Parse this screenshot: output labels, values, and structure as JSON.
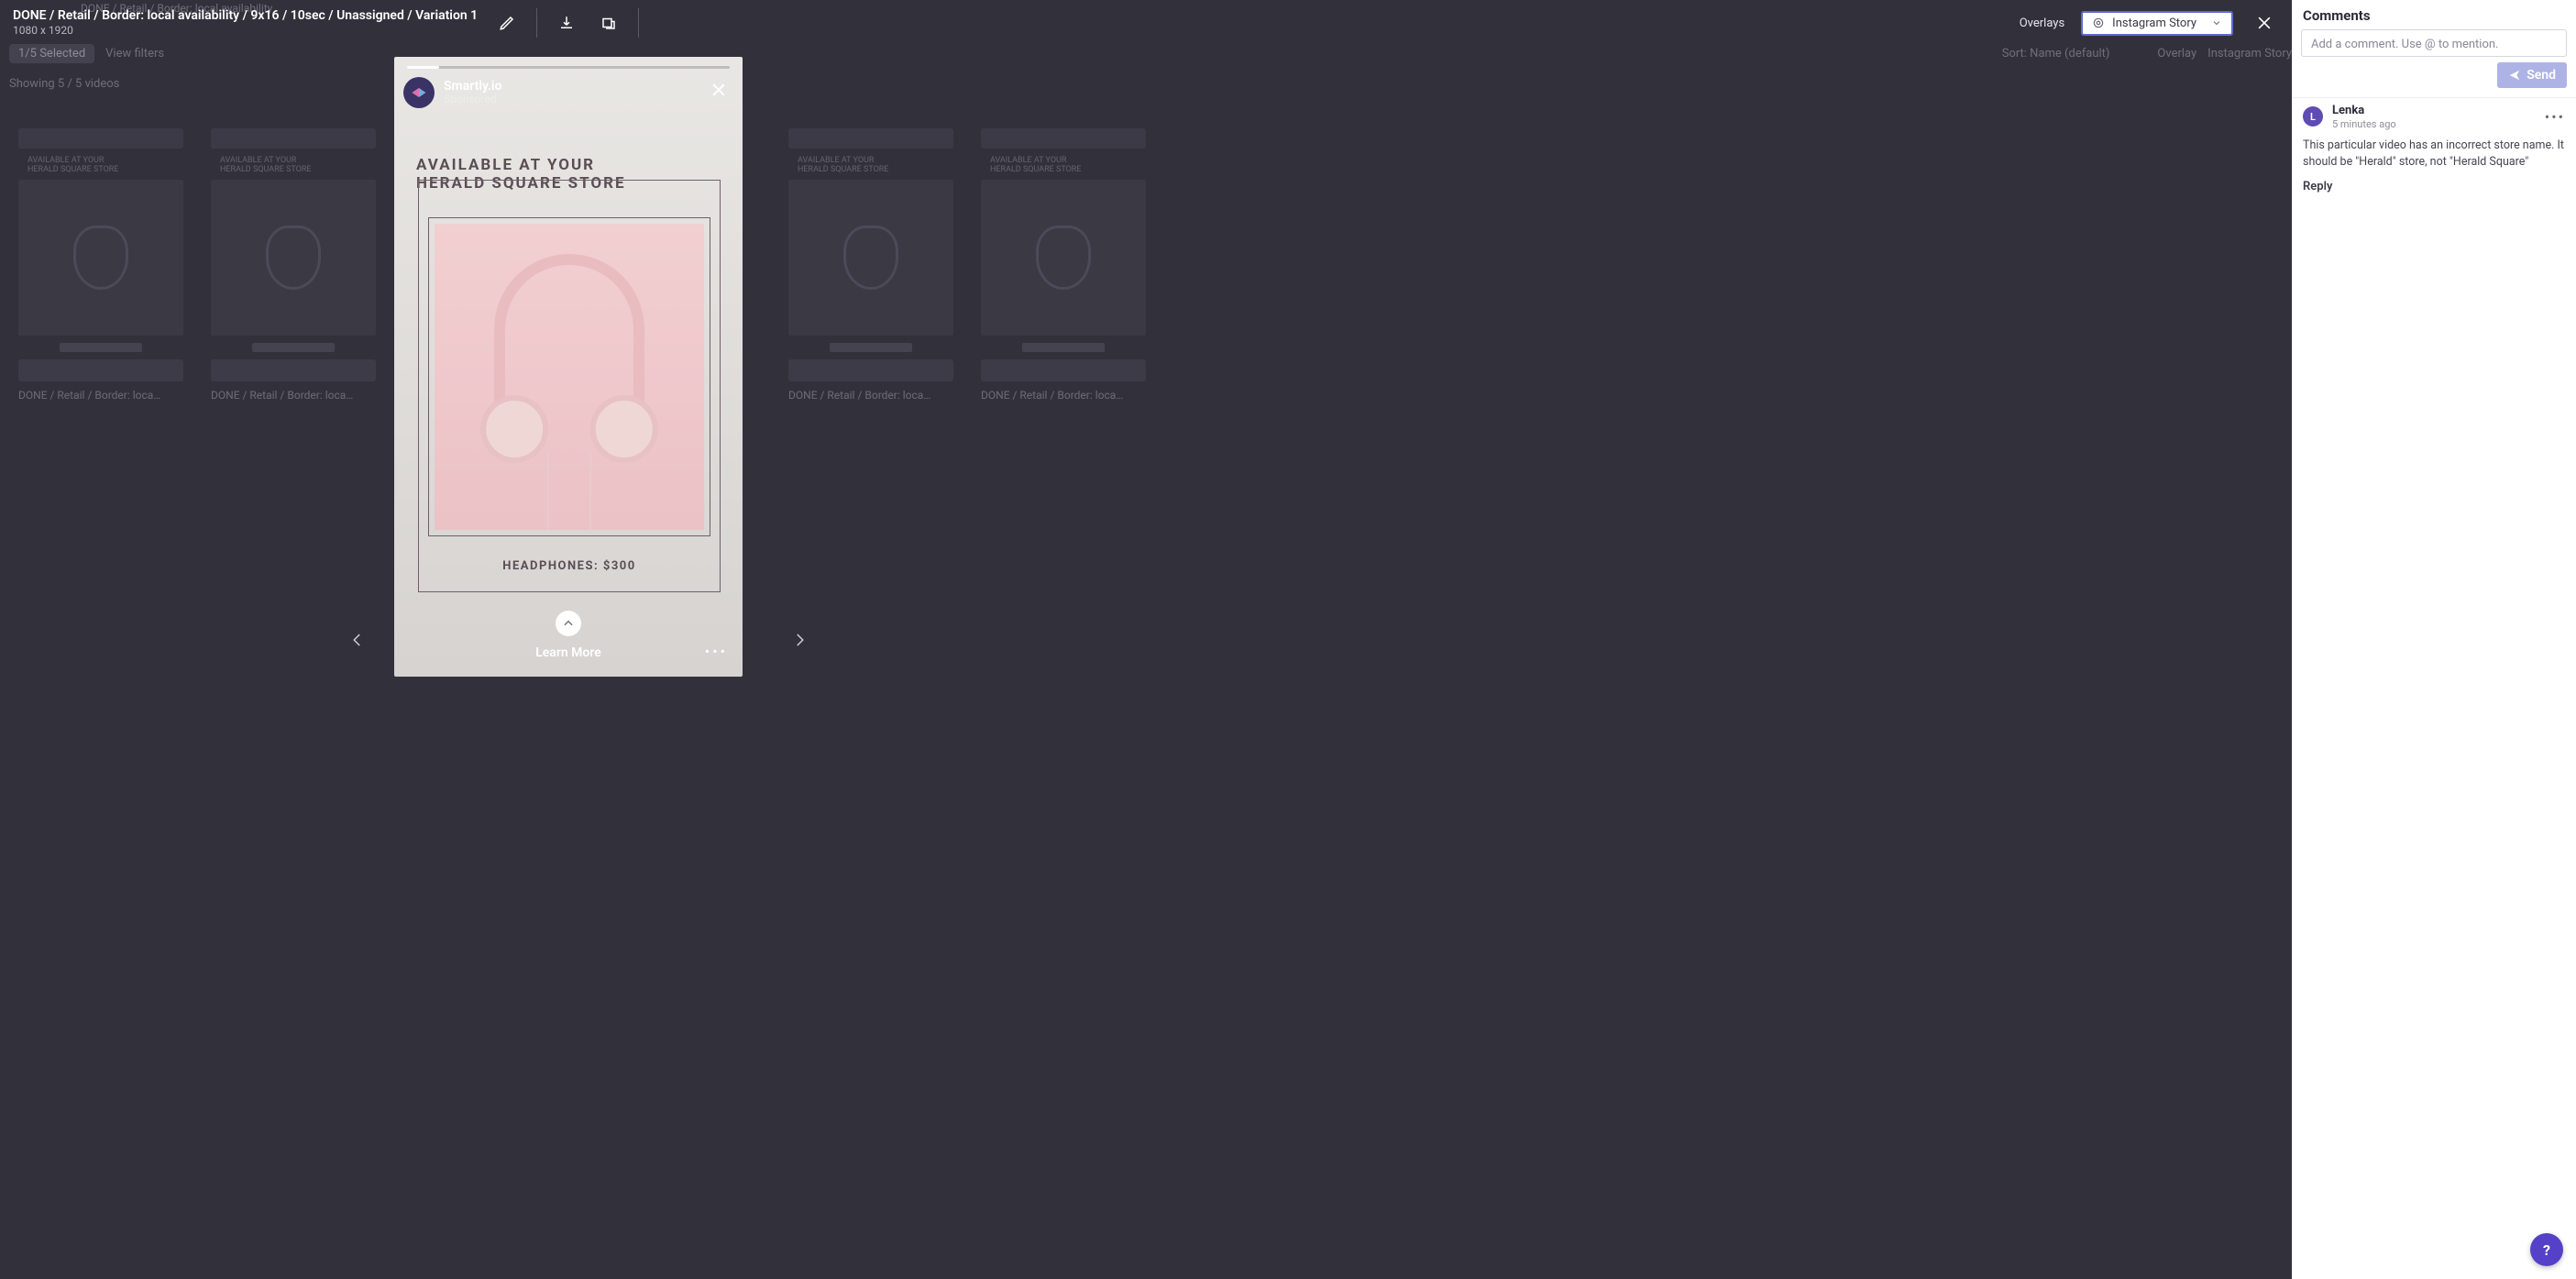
{
  "header": {
    "title": "DONE / Retail / Border: local availability / 9x16 / 10sec / Unassigned / Variation 1",
    "dimensions": "1080 x 1920",
    "overlays_label": "Overlays",
    "overlays_value": "Instagram Story"
  },
  "dim": {
    "breadcrumb": "DONE / Retail / Border: local availability",
    "selected_count_label": "1/5 Selected",
    "sort_label": "Sort: Name (default)",
    "view_filters_label": "View filters",
    "overlay_chip": "Overlay",
    "format_chip": "Instagram Story",
    "status_line": "Showing 5 / 5 videos",
    "card_meta": "DONE / Retail / Border: loca…",
    "card_small_line1": "AVAILABLE AT YOUR",
    "card_small_line2": "HERALD SQUARE STORE"
  },
  "story": {
    "brand": "Smartly.io",
    "sponsored": "Sponsored",
    "headline_line1": "AVAILABLE AT YOUR",
    "headline_line2": "HERALD SQUARE STORE",
    "product_label": "HEADPHONES: $300",
    "cta": "Learn More"
  },
  "comments": {
    "heading": "Comments",
    "placeholder": "Add a comment. Use @ to mention.",
    "send_label": "Send",
    "thread": {
      "avatar_initial": "L",
      "author": "Lenka",
      "time": "5 minutes ago",
      "body": "This particular video has an incorrect store name. It should be \"Herald\" store, not \"Herald Square\"",
      "reply_label": "Reply"
    }
  },
  "icons": {
    "help": "?"
  }
}
